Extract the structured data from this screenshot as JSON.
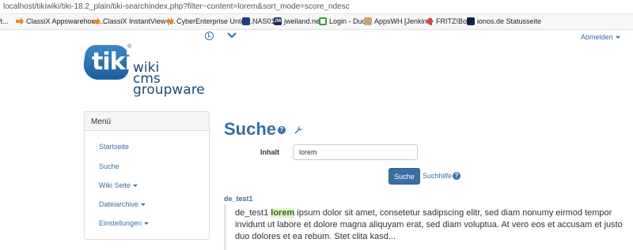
{
  "browser": {
    "url": "localhost/tikiwiki/tiki-18.2_plain/tiki-searchindex.php?filter~content=lorem&sort_mode=score_ndesc",
    "bookmarks": [
      {
        "label": "ft...",
        "icon": "folder-icon"
      },
      {
        "label": "ClassiX Appswarehous...",
        "icon": "bookmark-arrow-icon"
      },
      {
        "label": "ClassiX InstantView |...",
        "icon": "bookmark-arrow-icon"
      },
      {
        "label": "CyberEnterprise Unter...",
        "icon": "bookmark-arrow-icon"
      },
      {
        "label": "NAS01",
        "icon": "nas-icon"
      },
      {
        "label": "jweiland.net",
        "icon": "jw-icon"
      },
      {
        "label": "Login - Duo",
        "icon": "duo-icon"
      },
      {
        "label": "AppsWH [Jenkins]",
        "icon": "jenkins-icon"
      },
      {
        "label": "FRITZ!Box",
        "icon": "fritzbox-icon"
      },
      {
        "label": "ionos.de Statusseite",
        "icon": "ionos-icon"
      }
    ]
  },
  "header": {
    "logout_label": "Abmelden",
    "logo": {
      "brand": "tiki",
      "line1": "wiki",
      "line2": "cms",
      "line3": "groupware"
    }
  },
  "menu": {
    "title": "Menü",
    "items": [
      {
        "label": "Startseite"
      },
      {
        "label": "Suche"
      },
      {
        "label": "Wiki Seite"
      },
      {
        "label": "Dateiarchive"
      },
      {
        "label": "Einstellungen"
      }
    ]
  },
  "search": {
    "page_title": "Suche",
    "field_label": "Inhalt",
    "query": "lorem",
    "button_label": "Suche",
    "help_label": "Suchhilfe"
  },
  "results": [
    {
      "title": "de_test1",
      "snippet_before": "de_test1 ",
      "snippet_highlight": "lorem",
      "snippet_after": " ipsum dolor sit amet, consetetur sadipscing elitr, sed diam nonumy eirmod tempor invidunt ut labore et dolore magna aliquyam erat, sed diam voluptua. At vero eos et accusam et justo duo dolores et ea rebum. Stet clita kasd..."
    }
  ],
  "colors": {
    "link": "#3a6ea5",
    "highlight_bg": "#e5f2c9",
    "highlight_fg": "#2f6a1a"
  }
}
